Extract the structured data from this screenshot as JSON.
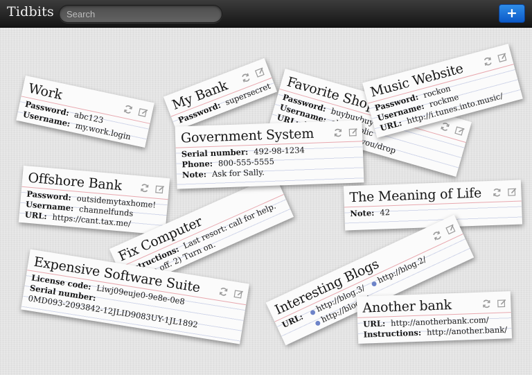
{
  "app": {
    "title": "Tidbits"
  },
  "search": {
    "placeholder": "Search"
  },
  "toolbar": {
    "add_label": "+"
  },
  "cards": {
    "work": {
      "title": "Work",
      "fields": [
        {
          "label": "Password:",
          "value": "abc123"
        },
        {
          "label": "Username:",
          "value": "my.work.login"
        }
      ]
    },
    "my_bank": {
      "title": "My Bank",
      "fields": [
        {
          "label": "Password:",
          "value": "supersecret"
        }
      ]
    },
    "favorite_shop": {
      "title": "Favorite Shop",
      "fields": [
        {
          "label": "Password:",
          "value": "buybuybuy"
        },
        {
          "label": "Username:",
          "value": "shopaholic"
        },
        {
          "label": "URL:",
          "value": "http://shop.till.you/drop"
        }
      ]
    },
    "music_website": {
      "title": "Music Website",
      "fields": [
        {
          "label": "Password:",
          "value": "rockon"
        },
        {
          "label": "Username:",
          "value": "rockme"
        },
        {
          "label": "URL:",
          "value": "http://i.tunes.into.music/"
        }
      ]
    },
    "government_system": {
      "title": "Government System",
      "fields": [
        {
          "label": "Serial number:",
          "value": "492-98-1234"
        },
        {
          "label": "Phone:",
          "value": "800-555-5555"
        },
        {
          "label": "Note:",
          "value": "Ask for Sally."
        }
      ]
    },
    "offshore_bank": {
      "title": "Offshore Bank",
      "fields": [
        {
          "label": "Password:",
          "value": "outsidemytaxhome!"
        },
        {
          "label": "Username:",
          "value": "channelfunds"
        },
        {
          "label": "URL:",
          "value": "https://cant.tax.me/"
        }
      ]
    },
    "the_meaning_of_life": {
      "title": "The Meaning of Life",
      "fields": [
        {
          "label": "Note:",
          "value": "42"
        }
      ]
    },
    "fix_computer": {
      "title": "Fix Computer",
      "fields": [
        {
          "label": "Instructions:",
          "value": "Last resort: call for help. 1) Turn off. 2) Turn on."
        }
      ]
    },
    "expensive_software_suite": {
      "title": "Expensive Software Suite",
      "fields": [
        {
          "label": "License code:",
          "value": "Liwj09euje0-9e8e-0e8"
        },
        {
          "label": "Serial number:",
          "value": ""
        }
      ],
      "serial_continued": "0MD093-2093842-12JLID9083UY-1JL1892"
    },
    "interesting_blogs": {
      "title": "Interesting Blogs",
      "url_label": "URL:",
      "urls": [
        "http://blog.3/",
        "http://blog.1/",
        "http://blog.2/"
      ]
    },
    "another_bank": {
      "title": "Another bank",
      "fields": [
        {
          "label": "URL:",
          "value": "http://anotherbank.com/"
        },
        {
          "label": "Instructions:",
          "value": "http://another.bank/"
        }
      ]
    }
  },
  "icons": {
    "refresh": "refresh-icon",
    "edit": "edit-icon"
  },
  "colors": {
    "card_bg": "#fbfbfb",
    "rule_line": "#d2d7ea",
    "header_rule": "#e8a7ae",
    "accent_button": "#1a6fd8",
    "icon_gray": "#9a9a9a"
  }
}
